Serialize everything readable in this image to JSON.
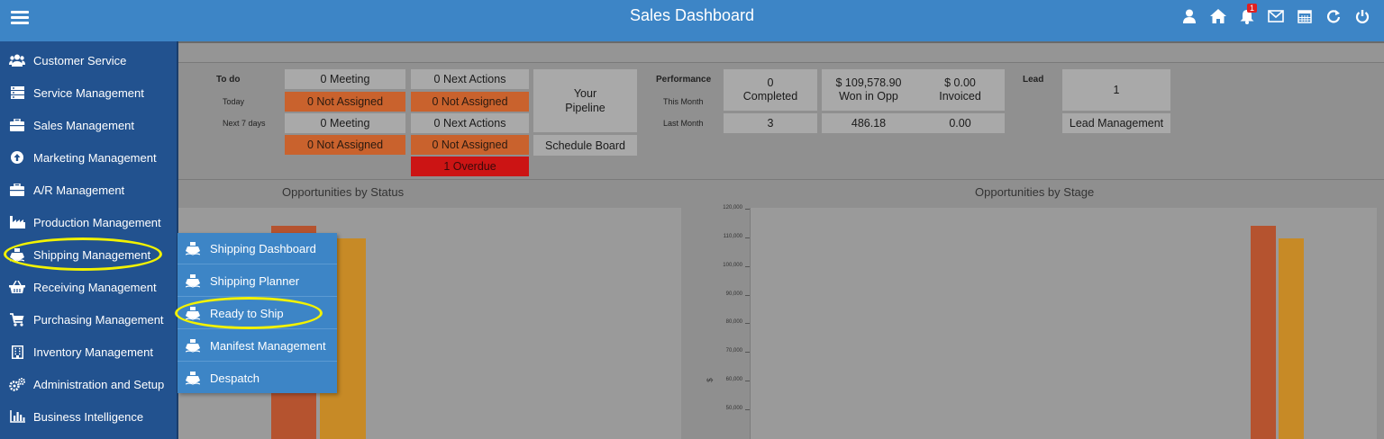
{
  "app": {
    "title": "Sales Dashboard"
  },
  "header_icons": [
    {
      "name": "user-icon"
    },
    {
      "name": "home-icon"
    },
    {
      "name": "bell-icon",
      "badge": "1"
    },
    {
      "name": "mail-icon"
    },
    {
      "name": "calendar-icon"
    },
    {
      "name": "refresh-icon"
    },
    {
      "name": "power-icon"
    }
  ],
  "sidebar": {
    "items": [
      {
        "label": "Customer Service",
        "icon": "users-icon"
      },
      {
        "label": "Service Management",
        "icon": "list-icon"
      },
      {
        "label": "Sales Management",
        "icon": "briefcase-icon"
      },
      {
        "label": "Marketing Management",
        "icon": "arrow-up-circle-icon"
      },
      {
        "label": "A/R Management",
        "icon": "briefcase-icon"
      },
      {
        "label": "Production Management",
        "icon": "factory-icon"
      },
      {
        "label": "Shipping Management",
        "icon": "ship-icon"
      },
      {
        "label": "Receiving Management",
        "icon": "basket-icon"
      },
      {
        "label": "Purchasing Management",
        "icon": "cart-icon"
      },
      {
        "label": "Inventory Management",
        "icon": "building-icon"
      },
      {
        "label": "Administration and Setup",
        "icon": "gears-icon"
      },
      {
        "label": "Business Intelligence",
        "icon": "bar-chart-icon"
      }
    ]
  },
  "flyout": {
    "items": [
      {
        "label": "Shipping Dashboard",
        "icon": "ship-icon"
      },
      {
        "label": "Shipping Planner",
        "icon": "ship-icon"
      },
      {
        "label": "Ready to Ship",
        "icon": "ship-icon"
      },
      {
        "label": "Manifest Management",
        "icon": "ship-icon"
      },
      {
        "label": "Despatch",
        "icon": "ship-icon"
      }
    ]
  },
  "todo": {
    "heading": "To do",
    "today_label": "Today",
    "next7_label": "Next 7 days",
    "today_meeting": "0 Meeting",
    "today_meeting_unassigned": "0 Not Assigned",
    "today_actions": "0 Next Actions",
    "today_actions_unassigned": "0 Not Assigned",
    "next7_meeting": "0 Meeting",
    "next7_meeting_unassigned": "0 Not Assigned",
    "next7_actions": "0 Next Actions",
    "next7_actions_unassigned": "0 Not Assigned",
    "overdue": "1 Overdue",
    "pipeline": "Your Pipeline",
    "schedule_board": "Schedule Board"
  },
  "performance": {
    "heading": "Performance",
    "this_month_label": "This Month",
    "last_month_label": "Last Month",
    "completed_value": "0",
    "completed_label": "Completed",
    "won_value": "$ 109,578.90",
    "won_label": "Won in Opp",
    "invoiced_value": "$ 0.00",
    "invoiced_label": "Invoiced",
    "last_completed": "3",
    "last_won": "486.18",
    "last_invoiced": "0.00"
  },
  "lead": {
    "heading": "Lead",
    "count": "1",
    "management": "Lead Management"
  },
  "colors": {
    "header": "#3d85c6",
    "sidebar": "#22528f",
    "orange": "#c9622d",
    "red": "#cc1414",
    "highlight": "#f2f200",
    "bar_red": "#b5532f",
    "bar_orange": "#c78a26"
  },
  "chart_data": [
    {
      "type": "bar",
      "title": "Opportunities by Status",
      "series": [
        {
          "values": [
            114000
          ]
        },
        {
          "values": [
            109578.9
          ]
        }
      ]
    },
    {
      "type": "bar",
      "title": "Opportunities by Stage",
      "ylabel": "$",
      "ylim": [
        50000,
        120000
      ],
      "yticks": [
        "120,000",
        "110,000",
        "100,000",
        "90,000",
        "80,000",
        "70,000",
        "60,000",
        "50,000"
      ],
      "series": [
        {
          "values": [
            114000
          ]
        },
        {
          "values": [
            109578.9
          ]
        }
      ]
    }
  ]
}
